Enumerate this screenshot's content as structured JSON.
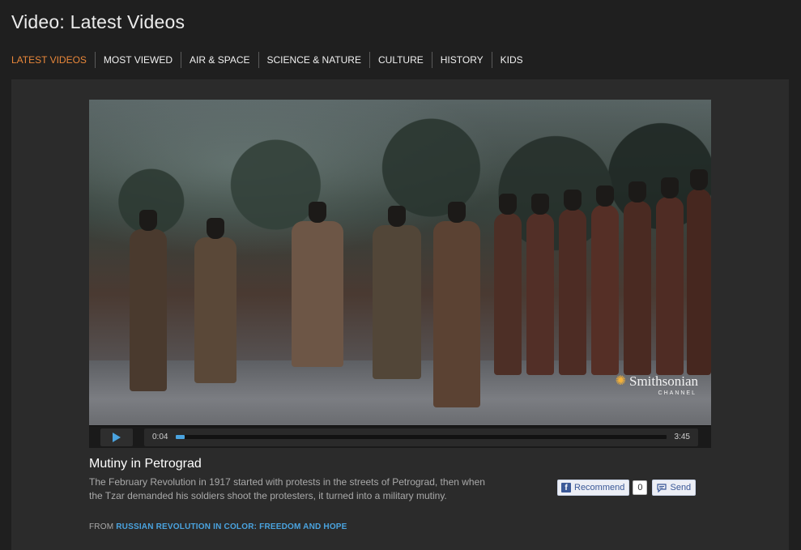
{
  "page": {
    "title": "Video: Latest Videos"
  },
  "nav": {
    "items": [
      {
        "label": "LATEST VIDEOS",
        "active": true
      },
      {
        "label": "MOST VIEWED"
      },
      {
        "label": "AIR & SPACE"
      },
      {
        "label": "SCIENCE & NATURE"
      },
      {
        "label": "CULTURE"
      },
      {
        "label": "HISTORY"
      },
      {
        "label": "KIDS"
      }
    ]
  },
  "player": {
    "watermark": {
      "brand": "Smithsonian",
      "sub": "CHANNEL"
    },
    "current_time": "0:04",
    "duration": "3:45",
    "progress_fraction": 0.018,
    "progress_color": "#4aa3df"
  },
  "video": {
    "title": "Mutiny in Petrograd",
    "description": "The February Revolution in 1917 started with protests in the streets of Petrograd, then when the Tzar demanded his soldiers shoot the protesters, it turned into a military mutiny.",
    "from_label": "FROM",
    "series": "RUSSIAN REVOLUTION IN COLOR: FREEDOM AND HOPE"
  },
  "social": {
    "recommend_label": "Recommend",
    "recommend_count": "0",
    "send_label": "Send"
  },
  "colors": {
    "accent": "#e8873a",
    "link": "#4aa3df",
    "facebook": "#3b5998"
  }
}
